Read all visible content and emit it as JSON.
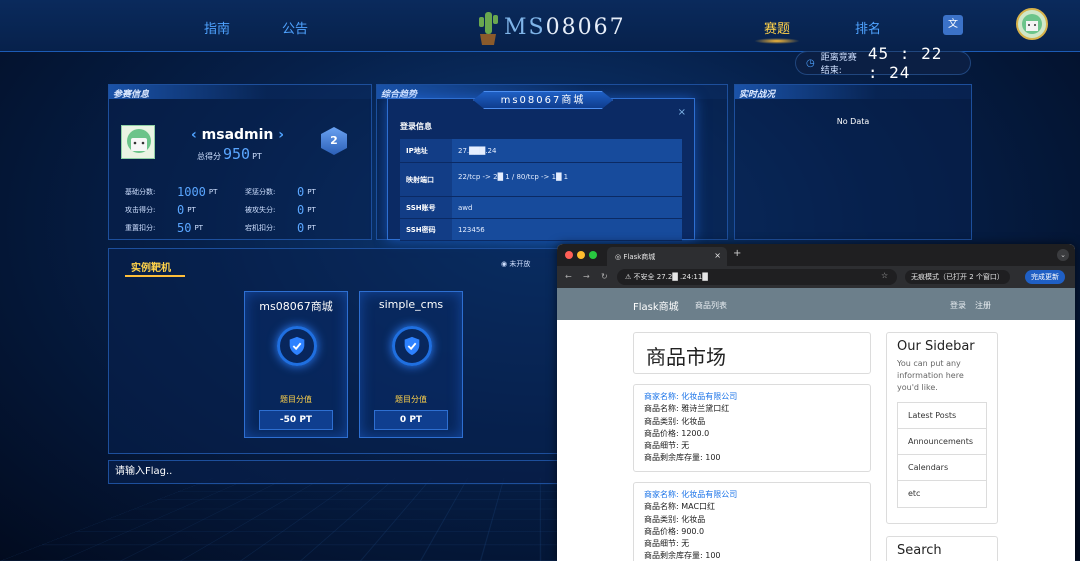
{
  "nav": {
    "guide": "指南",
    "notice": "公告",
    "challenges": "赛题",
    "ranking": "排名"
  },
  "brand": {
    "prefix": "MS",
    "number": "08067"
  },
  "timer": {
    "label": "距离竞赛结束:",
    "value": "45 : 22 : 24"
  },
  "info": {
    "title": "参赛信息",
    "username": "msadmin",
    "score_label": "总得分",
    "score_value": "950",
    "score_unit": "PT",
    "rank_badge": "2",
    "stats": [
      {
        "label": "基础分数:",
        "value": "1000",
        "unit": "PT"
      },
      {
        "label": "奖惩分数:",
        "value": "0",
        "unit": "PT"
      },
      {
        "label": "攻击得分:",
        "value": "0",
        "unit": "PT"
      },
      {
        "label": "被攻失分:",
        "value": "0",
        "unit": "PT"
      },
      {
        "label": "重置扣分:",
        "value": "50",
        "unit": "PT"
      },
      {
        "label": "宕机扣分:",
        "value": "0",
        "unit": "PT"
      }
    ]
  },
  "trend": {
    "title": "综合趋势"
  },
  "live": {
    "title": "实时战况",
    "nodata": "No Data"
  },
  "modal": {
    "title": "ms08067商城",
    "close": "×",
    "subtitle": "登录信息",
    "rows": [
      {
        "key": "IP地址",
        "value": "27.███.24"
      },
      {
        "key": "映射端口",
        "value": "22/tcp -> 2█ 1 / 80/tcp -> 1█ 1"
      },
      {
        "key": "SSH账号",
        "value": "awd"
      },
      {
        "key": "SSH密码",
        "value": "123456"
      }
    ]
  },
  "targets": {
    "title": "实例靶机",
    "legend_closed": "未开放",
    "cards": [
      {
        "name": "ms08067商城",
        "label": "题目分值",
        "value": "-50 PT"
      },
      {
        "name": "simple_cms",
        "label": "题目分值",
        "value": "0 PT"
      }
    ]
  },
  "flag": {
    "placeholder": "请输入Flag.."
  },
  "browser": {
    "tab_title": "Flask商城",
    "tab_close": "×",
    "new_tab": "+",
    "menu": "⌄",
    "insecure_label": "不安全",
    "url": "27.2█ .24:11█",
    "incognito": "无痕模式（已打开 2 个窗口）",
    "update": "完成更新",
    "site": {
      "brand": "Flask商城",
      "link_products": "商品列表",
      "login": "登录",
      "register": "注册",
      "market_title": "商品市场",
      "products": [
        {
          "merchant": "商家名称:  化妆品有限公司",
          "name": "商品名称:  雅诗兰黛口红",
          "category": "商品类别:  化妆品",
          "price": "商品价格:  1200.0",
          "detail": "商品细节:  无",
          "stock": "商品剩余库存量:  100"
        },
        {
          "merchant": "商家名称:  化妆品有限公司",
          "name": "商品名称:  MAC口红",
          "category": "商品类别:  化妆品",
          "price": "商品价格:  900.0",
          "detail": "商品细节:  无",
          "stock": "商品剩余库存量:  100"
        }
      ],
      "sidebar": {
        "title": "Our Sidebar",
        "desc": "You can put any information here you'd like.",
        "items": [
          "Latest Posts",
          "Announcements",
          "Calendars",
          "etc"
        ]
      },
      "search_title": "Search"
    }
  }
}
